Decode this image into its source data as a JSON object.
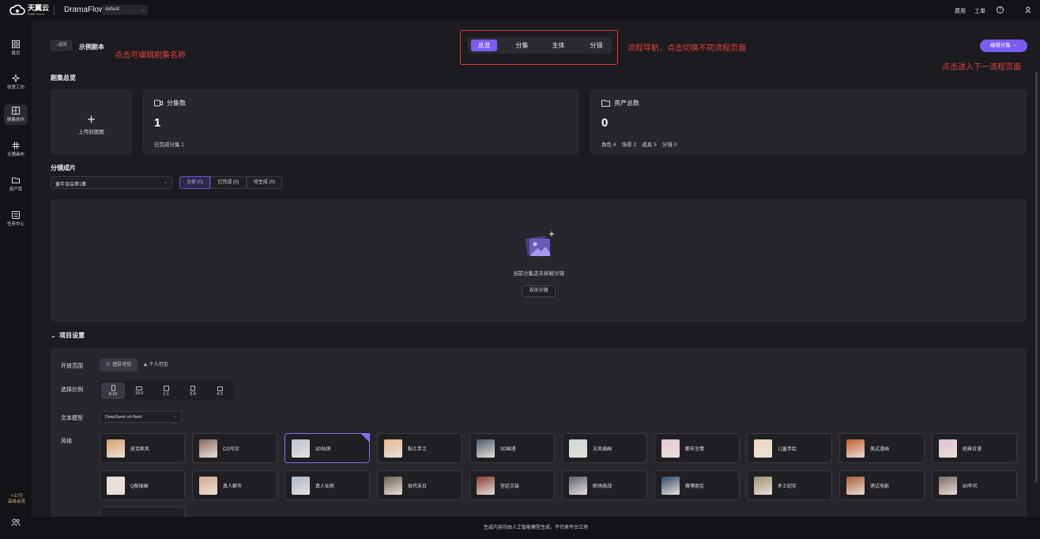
{
  "topbar": {
    "logo_cn": "天翼云",
    "logo_en": "State Cloud",
    "app_name": "DramaFlow",
    "workspace": "default",
    "links": [
      "费用",
      "工单"
    ]
  },
  "sidebar": {
    "items": [
      {
        "label": "首页",
        "icon": "home-grid-icon"
      },
      {
        "label": "创意工坊",
        "icon": "sparkle-icon"
      },
      {
        "label": "剧集创作",
        "icon": "book-icon"
      },
      {
        "label": "无限画布",
        "icon": "hash-icon"
      },
      {
        "label": "资产库",
        "icon": "folder-icon"
      },
      {
        "label": "任务中心",
        "icon": "task-icon"
      }
    ],
    "active_index": 2,
    "credits": "17万",
    "vip_label": "高级会员"
  },
  "header": {
    "back_label": "返回",
    "script_title": "示例剧本",
    "annot_title": "点击可编辑剧集名称",
    "flow_tabs": [
      "总览",
      "分集",
      "主体",
      "分镜"
    ],
    "flow_active": 0,
    "annot_flow": "流程导航，点击切换不同流程页面",
    "next_label": "编辑分集 →",
    "annot_next": "点击进入下一流程页面"
  },
  "overview": {
    "title": "剧集总览",
    "upload_label": "上传封面图",
    "episodes": {
      "label": "分集数",
      "value": "1",
      "sub": "已完成分集 1"
    },
    "assets": {
      "label": "资产总数",
      "value": "0",
      "sub": "角色 4    场景 2    道具 5    分镜 0"
    }
  },
  "storyboard": {
    "title": "分镜成片",
    "episode_select": "童年误会第1集",
    "filters": [
      "全部 (0)",
      "已完成 (0)",
      "待生成 (0)"
    ],
    "filter_active": 0,
    "empty_text": "当前分集还未拆解分镜",
    "empty_button": "去拆分镜"
  },
  "settings": {
    "title": "项目设置",
    "visibility_label": "开放范围",
    "visibility": [
      "团队可见",
      "个人可见"
    ],
    "visibility_active": 0,
    "ratio_label": "选择比例",
    "ratios": [
      "9:16",
      "16:9",
      "1:1",
      "3:4",
      "4:3"
    ],
    "ratio_active": 0,
    "model_label": "文本模型",
    "model_value": "DeepSeek-v4-flash",
    "style_label": "风格",
    "styles": [
      {
        "name": "皮克斯风",
        "color": "#d9a06a"
      },
      {
        "name": "CG写实",
        "color": "#8a6a5a"
      },
      {
        "name": "3D仙侠",
        "color": "#b8c4d4"
      },
      {
        "name": "黏土手工",
        "color": "#e8b890"
      },
      {
        "name": "3D国漫",
        "color": "#4a5a6a"
      },
      {
        "name": "古风插画",
        "color": "#c8d8d0"
      },
      {
        "name": "都市言情",
        "color": "#e8c8d0"
      },
      {
        "name": "儿童手绘",
        "color": "#f0d8b8"
      },
      {
        "name": "美式漫画",
        "color": "#c85a30"
      },
      {
        "name": "经典日漫",
        "color": "#e0c0d0"
      },
      {
        "name": "Q版插画",
        "color": "#e8e0d8"
      },
      {
        "name": "真人都市",
        "color": "#d8a890"
      },
      {
        "name": "真人仙侠",
        "color": "#a8b8c8"
      },
      {
        "name": "现代末日",
        "color": "#6a6050"
      },
      {
        "name": "宫廷古装",
        "color": "#8a3a30"
      },
      {
        "name": "职场商战",
        "color": "#5a6070"
      },
      {
        "name": "赛博朋克",
        "color": "#2a4a6a"
      },
      {
        "name": "乡土纪实",
        "color": "#a09070"
      },
      {
        "name": "港式电影",
        "color": "#b05a30"
      },
      {
        "name": "80年代",
        "color": "#7a6a60"
      }
    ],
    "active_style": 2
  },
  "footer": "生成内容均由人工智能模型生成，不代表平台立场",
  "colors": {
    "accent": "#7a5cf0",
    "annotation": "#e0403a"
  }
}
